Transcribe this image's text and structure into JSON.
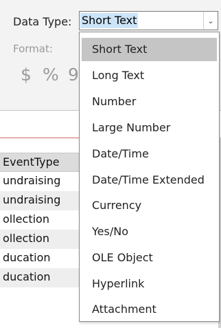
{
  "field_properties": {
    "data_type_label": "Data Type:",
    "data_type_value": "Short Text",
    "format_label": "Format:",
    "format_buttons": [
      {
        "icon": "currency-icon",
        "glyph": "$"
      },
      {
        "icon": "percent-icon",
        "glyph": "%"
      },
      {
        "icon": "comma-style-icon",
        "glyph": "9"
      }
    ]
  },
  "datasheet": {
    "column_header": "EventType",
    "rows": [
      "undraising",
      "undraising",
      "ollection",
      "ollection",
      "ducation",
      "ducation"
    ],
    "row_colors": [
      "#ffffff",
      "#eeeeee",
      "#ffffff",
      "#eeeeee",
      "#ffffff",
      "#eeeeee"
    ]
  },
  "dropdown": {
    "options": [
      "Short Text",
      "Long Text",
      "Number",
      "Large Number",
      "Date/Time",
      "Date/Time Extended",
      "Currency",
      "Yes/No",
      "OLE Object",
      "Hyperlink",
      "Attachment"
    ],
    "selected_index": 0
  }
}
